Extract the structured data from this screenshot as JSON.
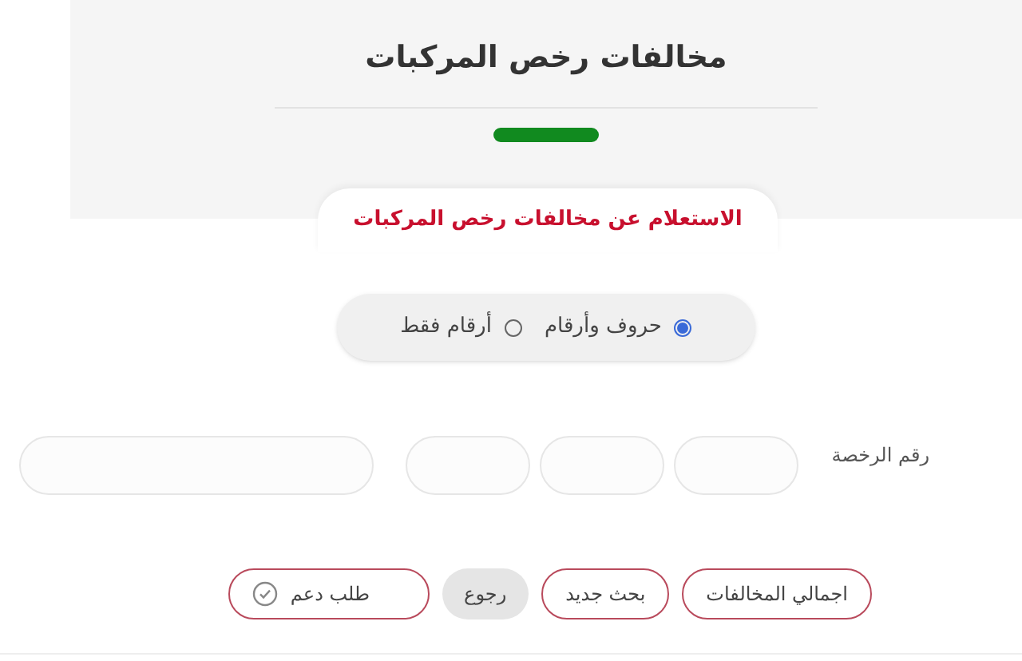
{
  "header": {
    "title": "مخالفات رخص المركبات"
  },
  "form_tab": {
    "title": "الاستعلام عن مخالفات رخص المركبات"
  },
  "plate_type": [
    {
      "label": "حروف وأرقام",
      "selected": true
    },
    {
      "label": "أرقام فقط",
      "selected": false
    }
  ],
  "license_number": {
    "label": "رقم الرخصة",
    "fields": [
      {
        "kind": "short"
      },
      {
        "kind": "short"
      },
      {
        "kind": "short"
      },
      {
        "kind": "long"
      }
    ]
  },
  "buttons": [
    {
      "label": "اجمالي المخالفات",
      "kind": "outline"
    },
    {
      "label": "بحث جديد",
      "kind": "outline"
    },
    {
      "label": "رجوع",
      "kind": "filled"
    },
    {
      "label": "طلب دعم",
      "kind": "support"
    }
  ]
}
